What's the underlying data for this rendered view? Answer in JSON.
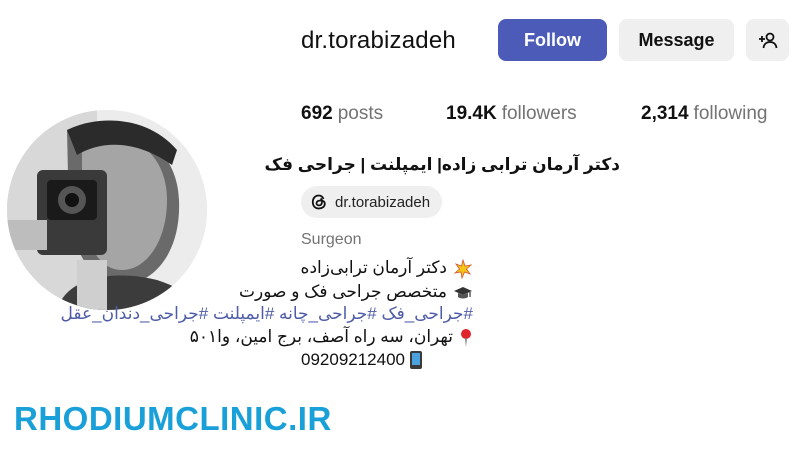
{
  "profile": {
    "username": "dr.torabizadeh",
    "follow_label": "Follow",
    "message_label": "Message",
    "stats": {
      "posts_count": "692",
      "posts_label": "posts",
      "followers_count": "19.4K",
      "followers_label": "followers",
      "following_count": "2,314",
      "following_label": "following"
    },
    "full_name": "دکتر آرمان ترابی زاده| ایمپلنت | جراحی فک",
    "threads_handle": "dr.torabizadeh",
    "category": "Surgeon",
    "bio": {
      "line1": "دکتر آرمان ترابی‌زاده",
      "line2": "متخصص جراحی فک و صورت",
      "hashtags": "#جراحی_فک #جراحی_چانه #ایمپلنت #جراحی_دندان_عقل",
      "address": "تهران، سه راه آصف، برج امین، وا۵۰۱",
      "phone": "09209212400"
    }
  },
  "watermark": "RHODIUMCLINIC.IR",
  "colors": {
    "follow_button": "#4b5bb7",
    "hashtag_text": "#4e5ca7",
    "watermark": "#1aa0d8"
  }
}
